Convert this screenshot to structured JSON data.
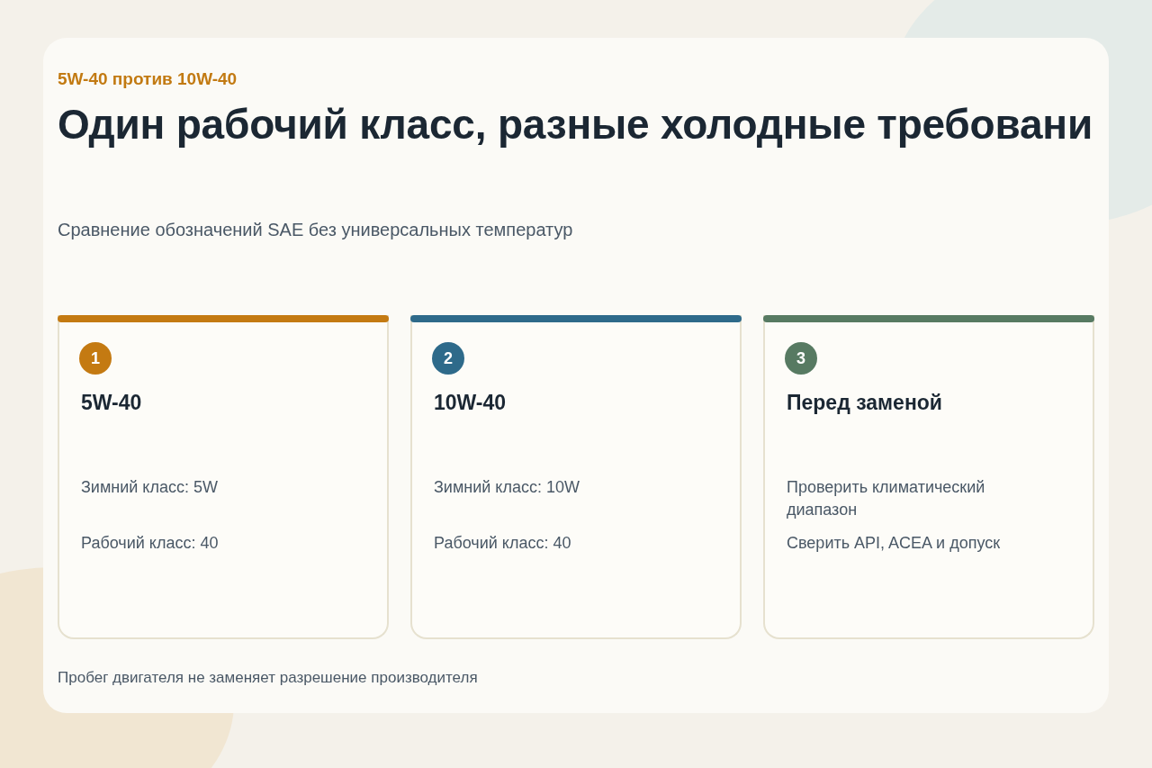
{
  "kicker": "5W-40 против 10W-40",
  "title": "Один рабочий класс, разные холодные требовани",
  "subtitle": "Сравнение обозначений SAE без универсальных температур",
  "cards": [
    {
      "number": "1",
      "color": "#c47a12",
      "heading": "5W-40",
      "lines": [
        "Зимний класс: 5W",
        "Рабочий класс: 40"
      ]
    },
    {
      "number": "2",
      "color": "#2e6a8a",
      "heading": "10W-40",
      "lines": [
        "Зимний класс: 10W",
        "Рабочий класс: 40"
      ]
    },
    {
      "number": "3",
      "color": "#577a62",
      "heading": "Перед заменой",
      "lines": [
        "Проверить климатический диапазон",
        "Сверить API, ACEA и допуск"
      ]
    }
  ],
  "footer": "Пробег двигателя не заменяет разрешение производителя"
}
